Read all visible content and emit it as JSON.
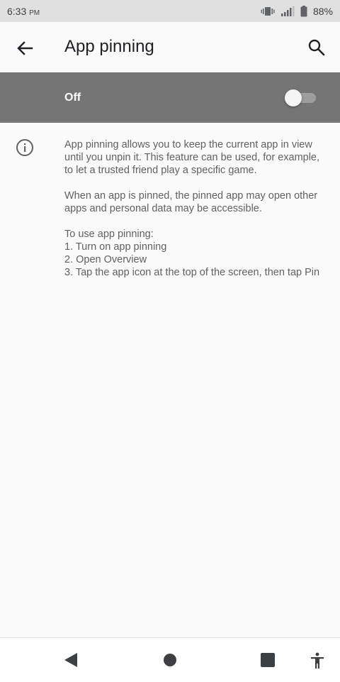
{
  "status_bar": {
    "time": "6:33",
    "ampm": "PM",
    "battery": "88%",
    "icons": [
      "vibrate-icon",
      "signal-icon",
      "battery-icon"
    ]
  },
  "app_bar": {
    "title": "App pinning",
    "back_icon": "arrow-back-icon",
    "search_icon": "search-icon"
  },
  "master_switch": {
    "label": "Off",
    "checked": false
  },
  "content": {
    "paragraph1": "App pinning allows you to keep the current app in view until you unpin it. This feature can be used, for example, to let a trusted friend play a specific game.",
    "paragraph2": "When an app is pinned, the pinned app may open other apps and personal data may be accessible.",
    "steps_intro": "To use app pinning:",
    "steps": [
      "1.  Turn on app pinning",
      "2.  Open Overview",
      "3.  Tap the app icon at the top of the screen, then tap Pin"
    ]
  },
  "nav_bar": {
    "icons": [
      "nav-back-icon",
      "nav-home-icon",
      "nav-recents-icon",
      "accessibility-icon"
    ]
  },
  "colors": {
    "status_bar_bg": "#e0e0e0",
    "master_bar_bg": "#757575",
    "page_bg": "#fafafa",
    "body_text": "#616161"
  }
}
